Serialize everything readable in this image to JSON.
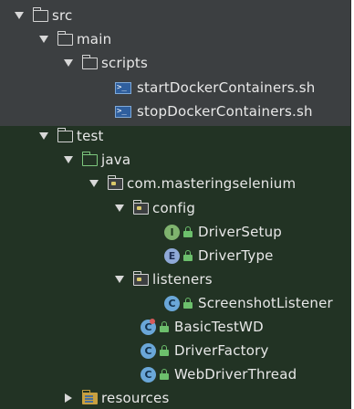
{
  "tree": {
    "src": "src",
    "main": "main",
    "scripts": "scripts",
    "start_script": "startDockerContainers.sh",
    "stop_script": "stopDockerContainers.sh",
    "test": "test",
    "java": "java",
    "package": "com.masteringselenium",
    "config": "config",
    "driver_setup": "DriverSetup",
    "driver_type": "DriverType",
    "listeners": "listeners",
    "screenshot_listener": "ScreenshotListener",
    "basic_test": "BasicTestWD",
    "driver_factory": "DriverFactory",
    "webdriver_thread": "WebDriverThread",
    "resources": "resources"
  },
  "icons": {
    "interface_letter": "I",
    "enum_letter": "E",
    "class_letter": "C",
    "shell_prompt": ">_"
  }
}
